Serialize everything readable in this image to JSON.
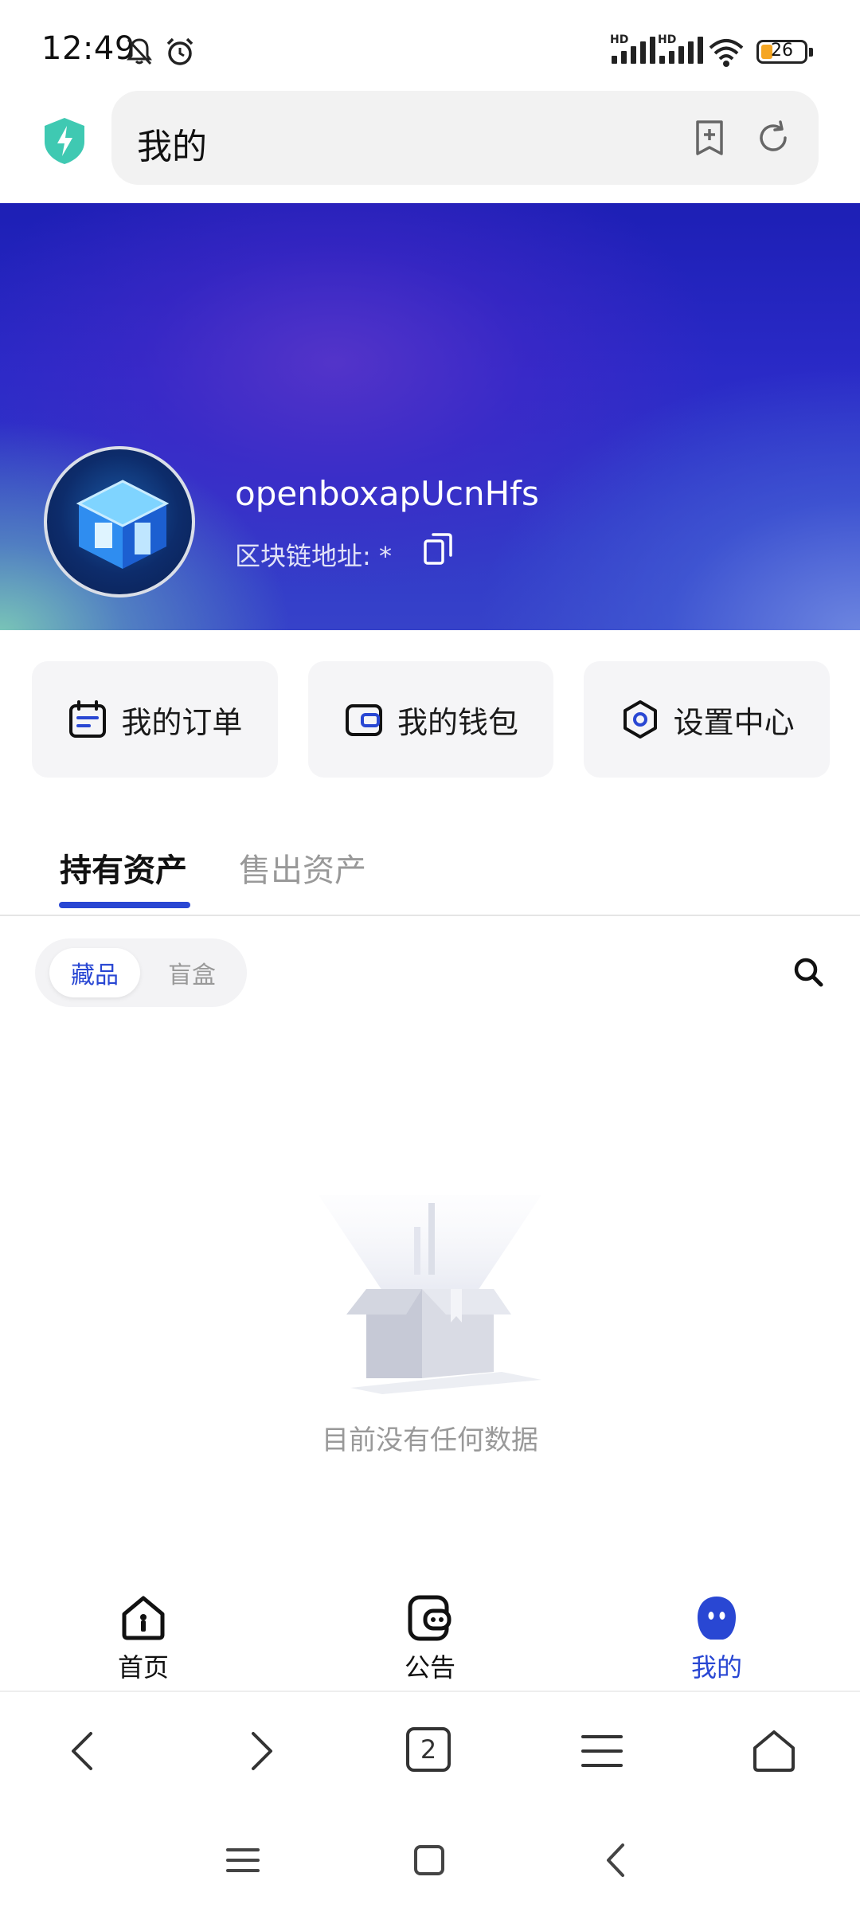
{
  "status_bar": {
    "time": "12:49",
    "hd1": "HD",
    "hd2": "HD",
    "battery": "26"
  },
  "browser": {
    "url_title": "我的",
    "icons": [
      "shield-bolt-icon",
      "bookmark-add-icon",
      "refresh-icon"
    ]
  },
  "profile": {
    "username": "openboxapUcnHfs",
    "chain_address_label": "区块链地址: *"
  },
  "actions": [
    {
      "label": "我的订单",
      "icon": "calendar-order-icon"
    },
    {
      "label": "我的钱包",
      "icon": "wallet-icon"
    },
    {
      "label": "设置中心",
      "icon": "settings-hexagon-icon"
    }
  ],
  "tabs": {
    "active": "持有资产",
    "inactive": "售出资产"
  },
  "segment": {
    "active": "藏品",
    "inactive": "盲盒"
  },
  "empty_state": {
    "text": "目前没有任何数据"
  },
  "app_nav": [
    {
      "label": "首页",
      "icon": "home-icon"
    },
    {
      "label": "公告",
      "icon": "announcement-icon"
    },
    {
      "label": "我的",
      "icon": "profile-icon",
      "active": true
    }
  ],
  "browser_toolbar": {
    "tab_count": "2"
  },
  "colors": {
    "accent": "#2947d3",
    "banner_dark": "#1d1fb5"
  }
}
